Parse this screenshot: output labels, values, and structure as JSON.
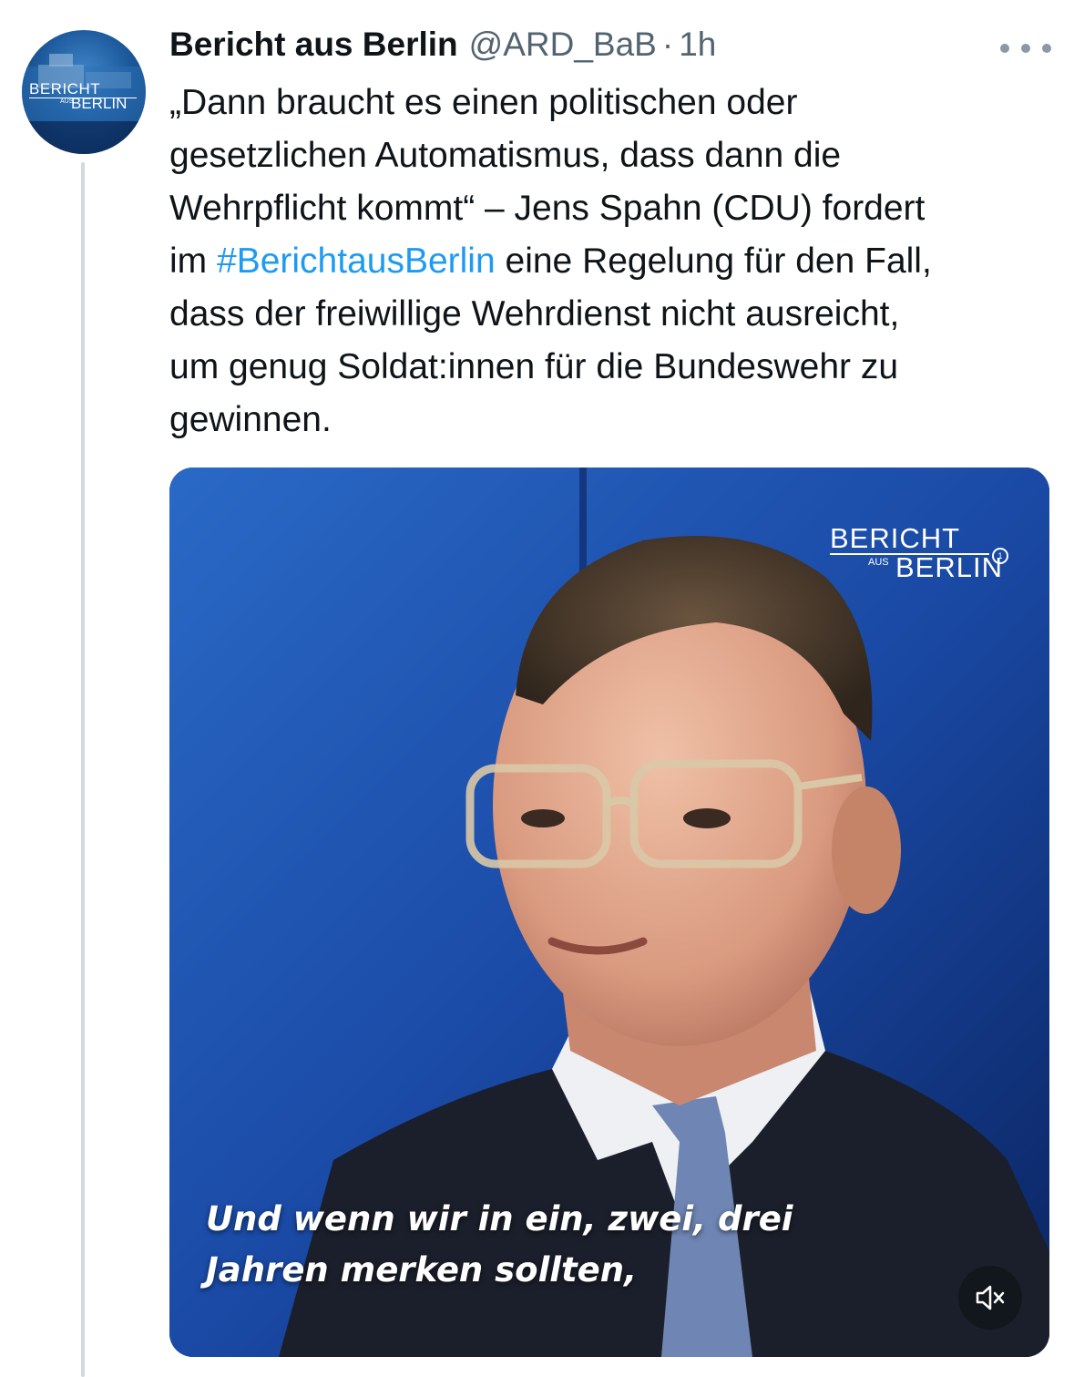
{
  "tweet": {
    "author_name": "Bericht aus Berlin",
    "handle": "@ARD_BaB",
    "separator": "·",
    "time": "1h",
    "text_lines": [
      "„Dann braucht es einen politischen oder",
      "gesetzlichen Automatismus, dass dann die",
      "Wehrpflicht kommt“ – Jens Spahn (CDU) fordert"
    ],
    "text_prefix_line4": "im ",
    "hashtag": "#BerichtausBerlin",
    "text_after_hashtag": " eine Regelung für den Fall,",
    "text_lines_end": [
      "dass der freiwillige Wehrdienst nicht ausreicht,",
      "um genug Soldat:innen für die Bundeswehr zu",
      "gewinnen."
    ]
  },
  "avatar": {
    "logo_line1": "BERICHT",
    "logo_line2": "AUS",
    "logo_line3": "BERLIN",
    "logo_mark": "①"
  },
  "video": {
    "logo_line1": "BERICHT",
    "logo_line2": "AUS",
    "logo_line3": "BERLIN",
    "logo_mark": "1",
    "subtitle_line1": "Und wenn wir in ein, zwei, drei",
    "subtitle_line2": "Jahren merken sollten,"
  },
  "icons": {
    "more": "more-horizontal-icon",
    "mute": "volume-muted-icon"
  },
  "colors": {
    "text": "#0f1419",
    "secondary": "#536471",
    "link": "#1d9bf0",
    "thread_line": "#cfd9de",
    "video_bg": "#13327a"
  }
}
